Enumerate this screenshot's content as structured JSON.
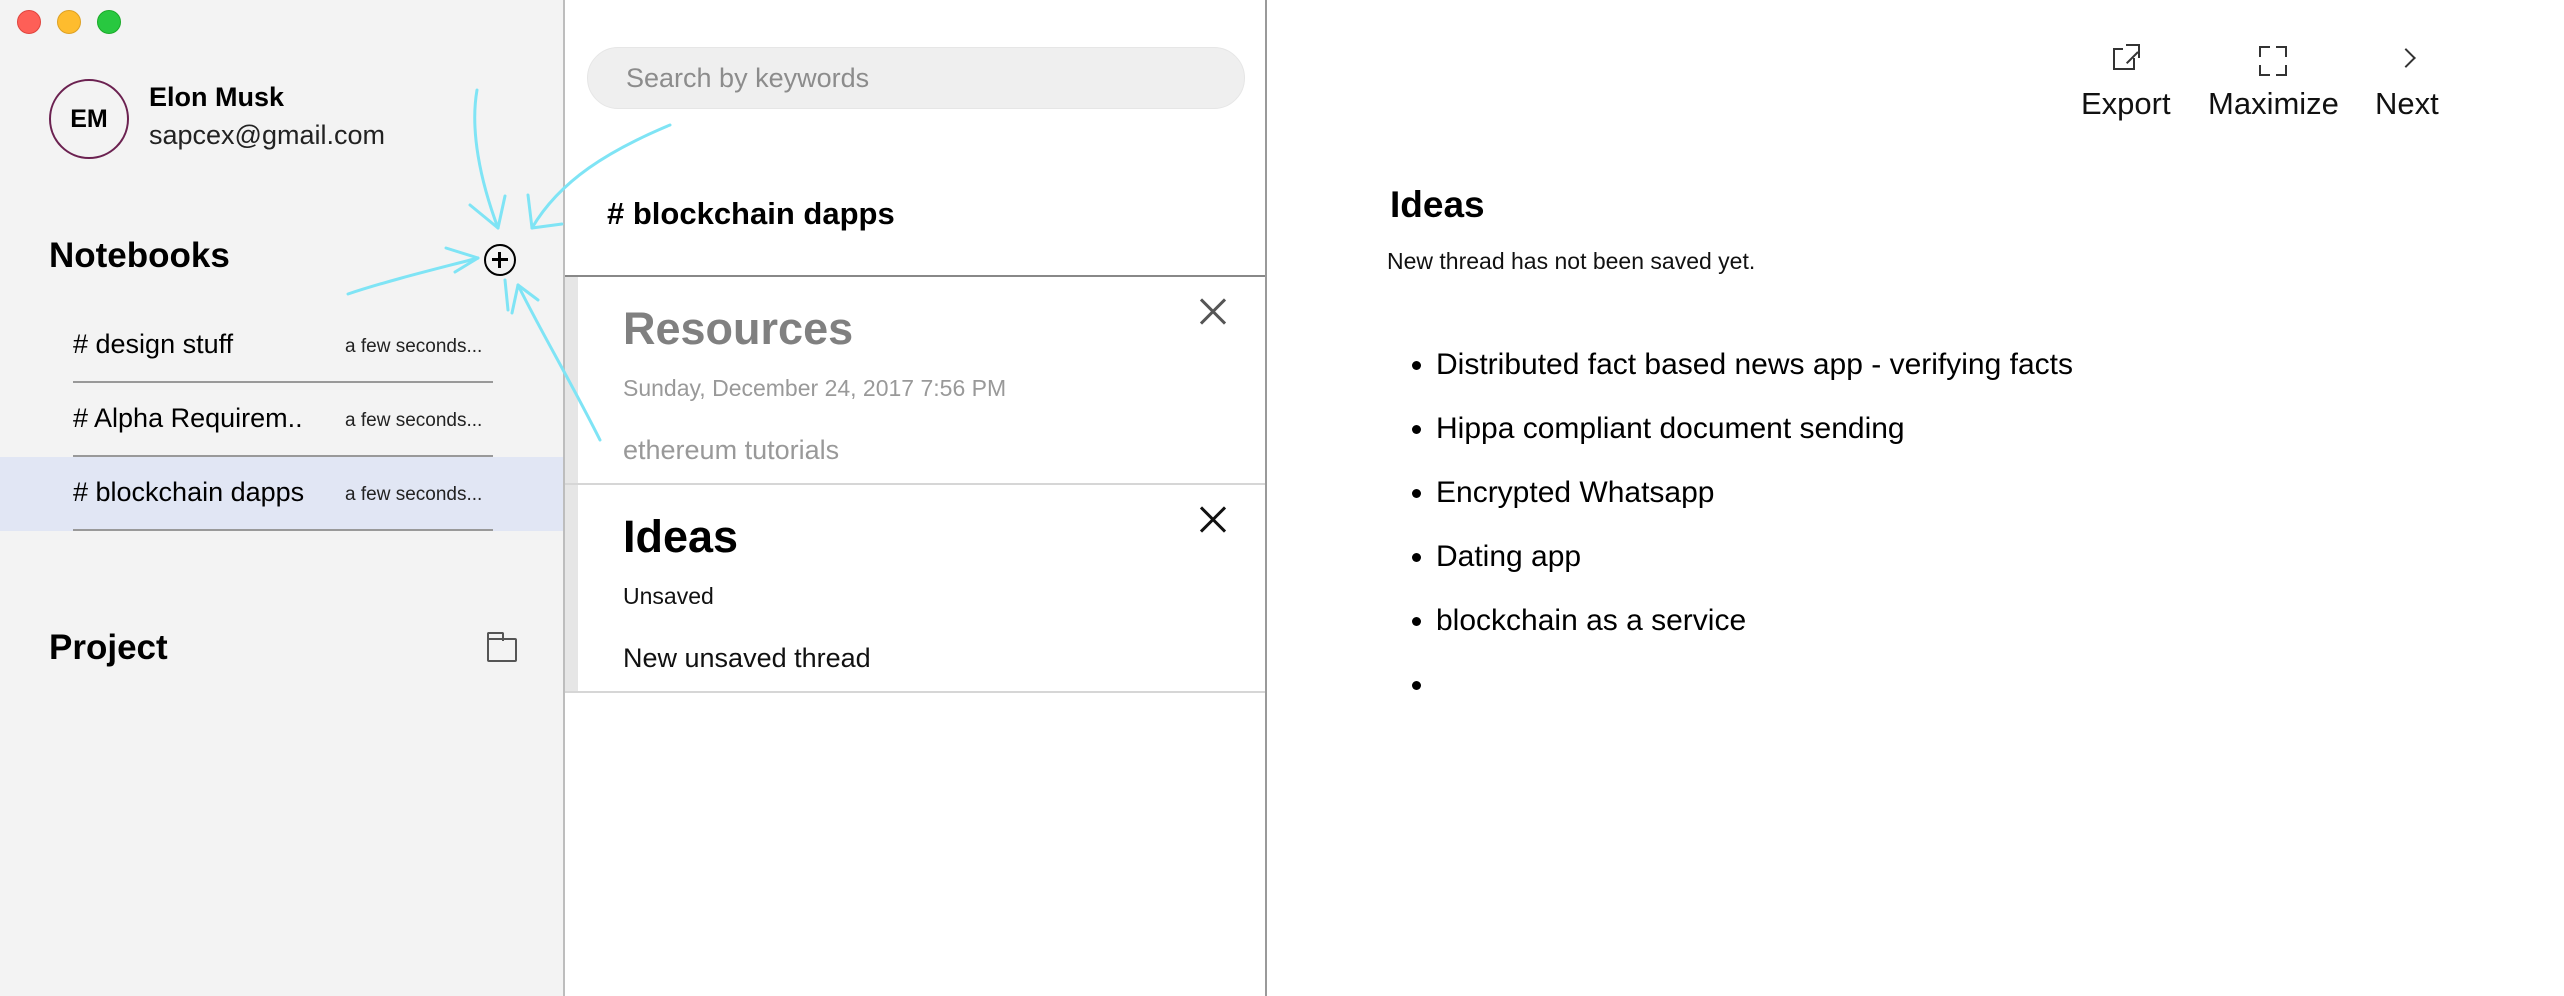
{
  "sidebar": {
    "user": {
      "initials": "EM",
      "name": "Elon Musk",
      "email": "sapcex@gmail.com"
    },
    "notebooks_title": "Notebooks",
    "notebooks": [
      {
        "name": "# design stuff",
        "time": "a few seconds...",
        "selected": false
      },
      {
        "name": "# Alpha Requirem..",
        "time": "a few seconds...",
        "selected": false
      },
      {
        "name": "# blockchain dapps",
        "time": "a few seconds...",
        "selected": true
      }
    ],
    "project_title": "Project"
  },
  "middle": {
    "search_placeholder": "Search by keywords",
    "notebook_heading": "# blockchain dapps",
    "threads": [
      {
        "title": "Resources",
        "subtitle": "Sunday, December 24, 2017 7:56 PM",
        "body": "ethereum tutorials"
      },
      {
        "title": "Ideas",
        "subtitle": "Unsaved",
        "body": "New unsaved thread"
      }
    ]
  },
  "toolbar": {
    "export_label": "Export",
    "maximize_label": "Maximize",
    "next_label": "Next"
  },
  "document": {
    "title": "Ideas",
    "status": "New thread has not been saved yet.",
    "bullets": [
      "Distributed fact based news app - verifying facts",
      "Hippa compliant document sending",
      "Encrypted Whatsapp",
      "Dating app",
      "blockchain as a service",
      ""
    ]
  },
  "colors": {
    "sidebar_bg": "#f3f3f3",
    "selected_bg": "#e1e6f4",
    "annotation": "#7fe4f5",
    "avatar_ring": "#6b2150"
  }
}
